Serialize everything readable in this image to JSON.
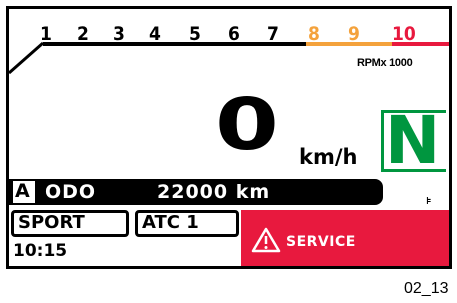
{
  "tachometer": {
    "ticks": [
      {
        "label": "1",
        "color": "#000000"
      },
      {
        "label": "2",
        "color": "#000000"
      },
      {
        "label": "3",
        "color": "#000000"
      },
      {
        "label": "4",
        "color": "#000000"
      },
      {
        "label": "5",
        "color": "#000000"
      },
      {
        "label": "6",
        "color": "#000000"
      },
      {
        "label": "7",
        "color": "#000000"
      },
      {
        "label": "8",
        "color": "#f4a23c"
      },
      {
        "label": "9",
        "color": "#f4a23c"
      },
      {
        "label": "10",
        "color": "#e8193e"
      }
    ],
    "unit": "RPMx 1000",
    "zone_colors": {
      "normal": "#000000",
      "caution": "#f4a23c",
      "redline": "#e8193e"
    }
  },
  "speed": {
    "value": "0",
    "unit": "km/h"
  },
  "gear": {
    "value": "N",
    "color": "#00963f"
  },
  "odometer": {
    "mode": "A",
    "label": "ODO",
    "value": "22000 km"
  },
  "status": {
    "riding_mode": "SPORT",
    "traction_control": "ATC 1",
    "clock": "10:15"
  },
  "service": {
    "label": "SERVICE",
    "icon": "warning-triangle-icon",
    "color": "#e8193e"
  },
  "misc_mark": "⊧",
  "caption": "02_13"
}
